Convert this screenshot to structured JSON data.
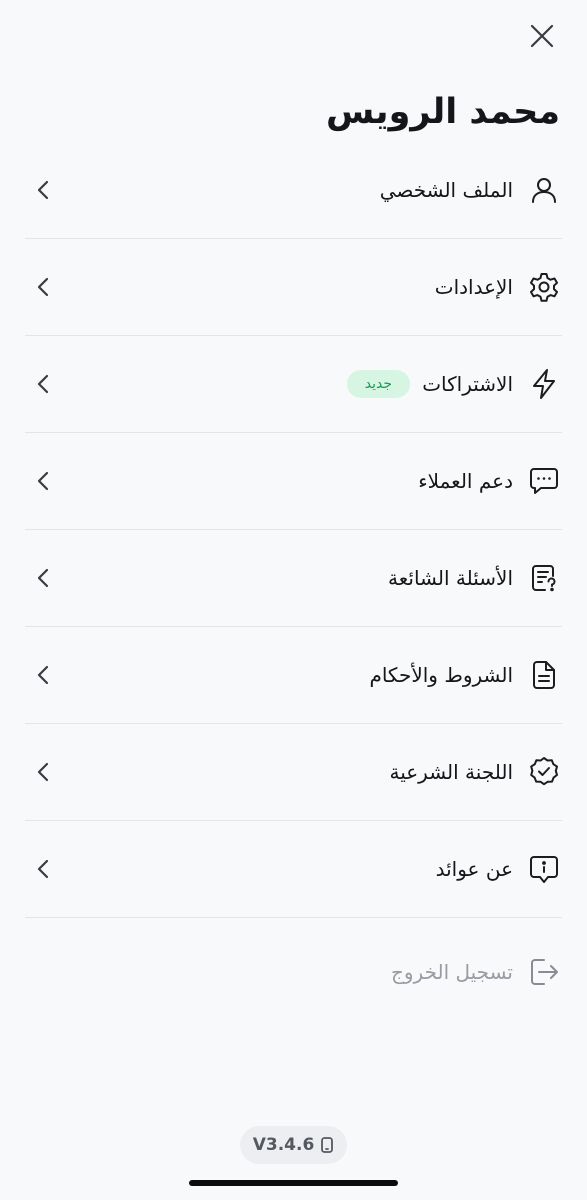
{
  "header": {
    "title": "محمد الرويس"
  },
  "menu": {
    "items": [
      {
        "label": "الملف الشخصي",
        "icon": "user-icon"
      },
      {
        "label": "الإعدادات",
        "icon": "gear-icon"
      },
      {
        "label": "الاشتراكات",
        "icon": "lightning-icon",
        "badge": "جديد"
      },
      {
        "label": "دعم العملاء",
        "icon": "chat-bubble-icon"
      },
      {
        "label": "الأسئلة الشائعة",
        "icon": "faq-document-icon"
      },
      {
        "label": "الشروط والأحكام",
        "icon": "document-icon"
      },
      {
        "label": "اللجنة الشرعية",
        "icon": "verified-badge-icon"
      },
      {
        "label": "عن عوائد",
        "icon": "info-bubble-icon"
      }
    ]
  },
  "logout": {
    "label": "تسجيل الخروج",
    "icon": "logout-icon"
  },
  "footer": {
    "version": "V3.4.6",
    "icon": "phone-icon"
  },
  "colors": {
    "background": "#f8f9fb",
    "badge_bg": "#d7f5e3",
    "badge_text": "#1e9a54",
    "muted_text": "#9a9ca3"
  }
}
